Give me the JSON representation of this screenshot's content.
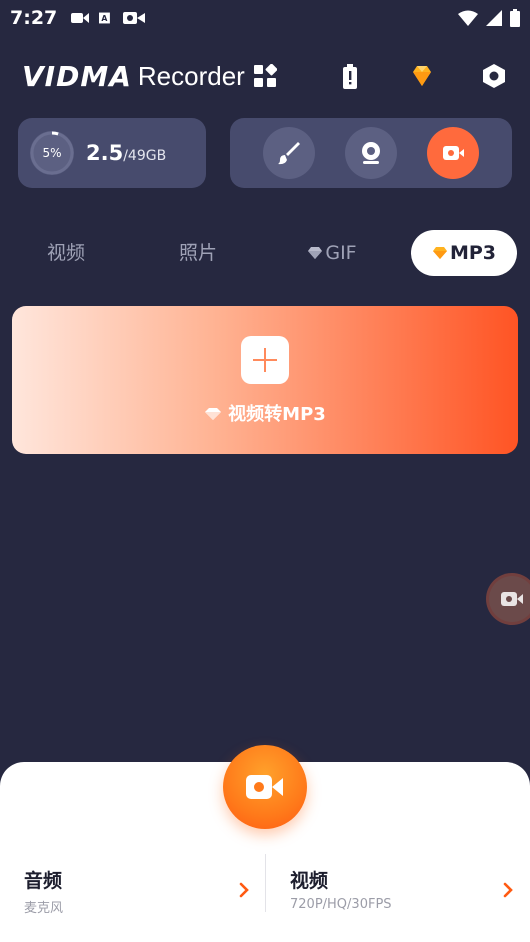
{
  "status_bar": {
    "time": "7:27",
    "left_icons": [
      "video-icon",
      "text-a-icon",
      "camera-icon"
    ],
    "right_icons": [
      "wifi-icon",
      "signal-icon",
      "battery-icon"
    ]
  },
  "header": {
    "brand": "VIDMA",
    "brand_suffix": "Recorder",
    "icons": [
      "apps-grid-icon",
      "battery-alert-icon",
      "diamond-icon",
      "settings-hex-icon"
    ]
  },
  "storage": {
    "percent_label": "5%",
    "used": "2.5",
    "total": "/49GB",
    "percent": 5
  },
  "tools": [
    "brush-icon",
    "webcam-icon",
    "record-icon"
  ],
  "tabs": [
    {
      "label": "视频",
      "premium": false,
      "selected": false
    },
    {
      "label": "照片",
      "premium": false,
      "selected": false
    },
    {
      "label": "GIF",
      "premium": true,
      "selected": false
    },
    {
      "label": "MP3",
      "premium": true,
      "selected": true
    }
  ],
  "convert": {
    "label": "视频转MP3"
  },
  "bottom": {
    "audio_title": "音频",
    "audio_sub": "麦克风",
    "video_title": "视频",
    "video_sub": "720P/HQ/30FPS"
  },
  "colors": {
    "background": "#262840",
    "card": "#474b6d",
    "accent": "#ff6a3d",
    "gem": "#ffb21f"
  }
}
